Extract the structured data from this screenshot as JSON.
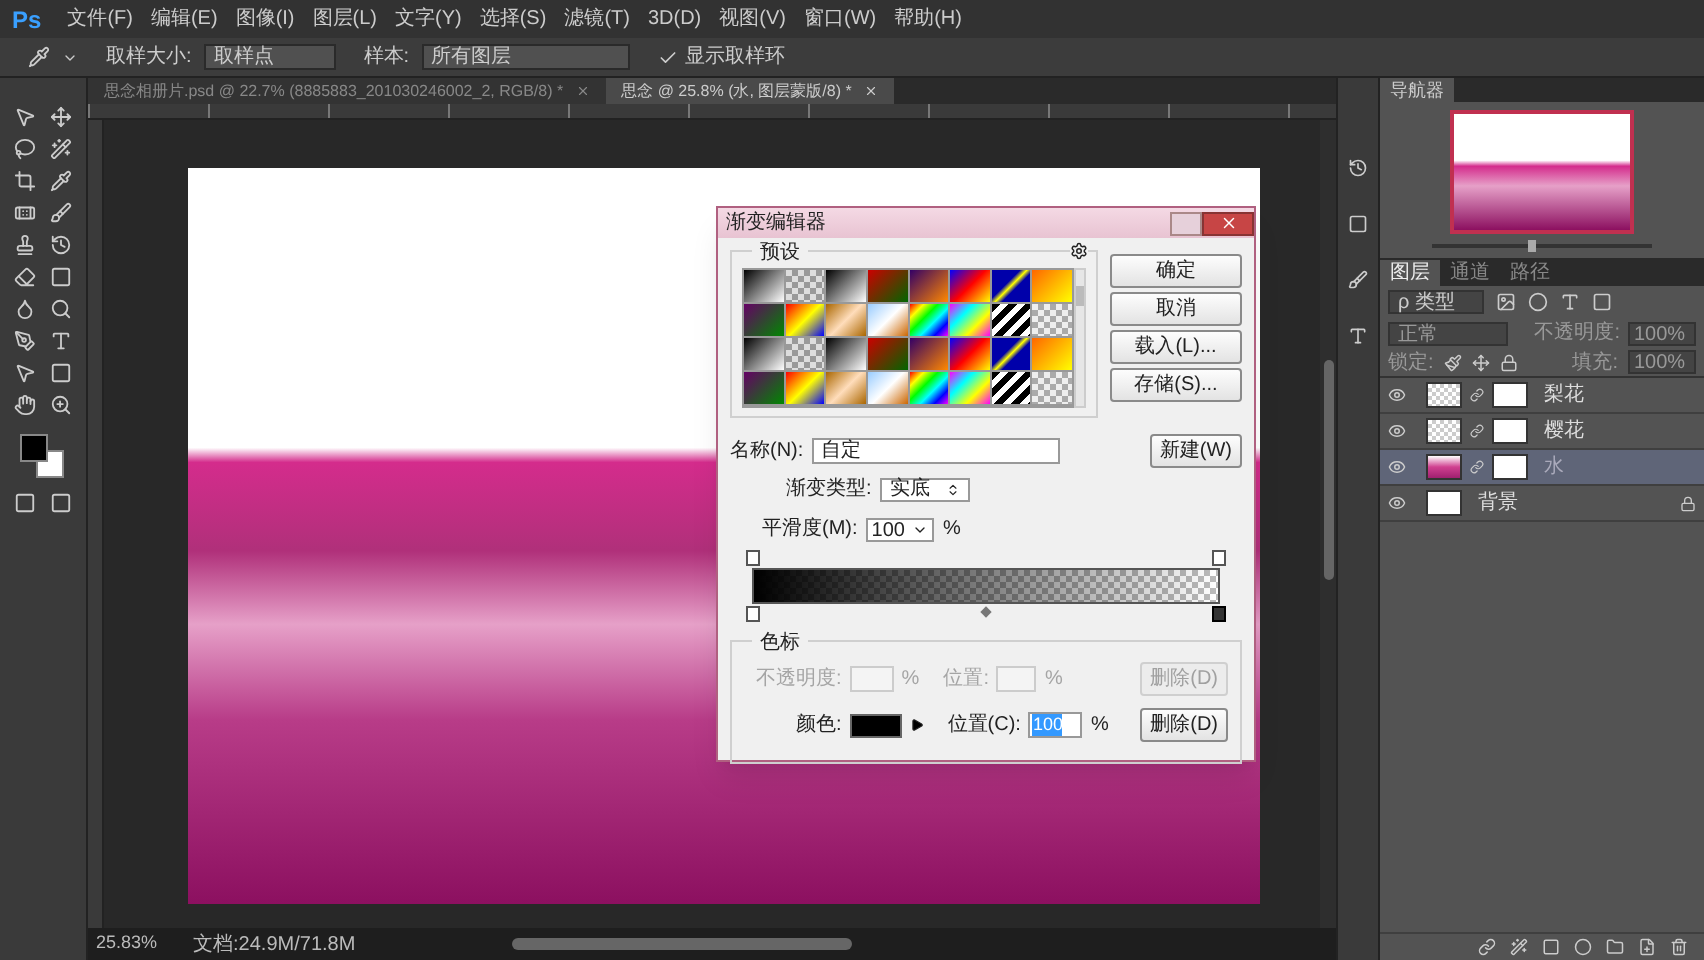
{
  "app_logo": "Ps",
  "menu": [
    "文件(F)",
    "编辑(E)",
    "图像(I)",
    "图层(L)",
    "文字(Y)",
    "选择(S)",
    "滤镜(T)",
    "3D(D)",
    "视图(V)",
    "窗口(W)",
    "帮助(H)"
  ],
  "options_bar": {
    "sample_size_label": "取样大小:",
    "sample_size": "取样点",
    "sample_label": "样本:",
    "sample": "所有图层",
    "show_ring": {
      "label": "显示取样环",
      "checked": true
    }
  },
  "doc_tabs": [
    {
      "label": "思念相册片.psd @ 22.7% (8885883_201030246002_2, RGB/8) *",
      "selected": false
    },
    {
      "label": "思念 @ 25.8% (水, 图层蒙版/8) *",
      "selected": true
    }
  ],
  "status_bar": {
    "zoom": "25.83%",
    "doc_size": "文档:24.9M/71.8M"
  },
  "dialog": {
    "title": "渐变编辑器",
    "presets_label": "预设",
    "buttons": [
      "确定",
      "取消",
      "载入(L)...",
      "存储(S)..."
    ],
    "name_label": "名称(N):",
    "name_value": "自定",
    "new_button": "新建(W)",
    "type_label": "渐变类型:",
    "type_value": "实底",
    "smooth_label": "平滑度(M):",
    "smooth_value": "100",
    "smooth_unit": "%",
    "opacity_stops": [
      {
        "selected": false
      },
      {
        "selected": false
      }
    ],
    "color_stops": [
      {
        "selected": false
      },
      {
        "selected": true
      }
    ],
    "stops_group": {
      "title": "色标",
      "opacity_label": "不透明度:",
      "opacity_unit": "%",
      "opacity_location_label": "位置:",
      "opacity_location_unit": "%",
      "opacity_delete": "删除(D)",
      "opacity_disabled": true,
      "color_label": "颜色:",
      "color": "#000000",
      "location_label": "位置(C):",
      "location_value": "100",
      "location_unit": "%",
      "delete": "删除(D)"
    }
  },
  "navigator": {
    "title": "导航器",
    "level": 0.45
  },
  "layers_panel": {
    "tabs": [
      {
        "label": "图层",
        "selected": true
      },
      {
        "label": "通道",
        "selected": false
      },
      {
        "label": "路径",
        "selected": false
      }
    ],
    "filter": "ρ 类型",
    "blend_mode": "正常",
    "opacity_label": "不透明度:",
    "opacity": "100%",
    "lock_label": "锁定:",
    "fill_label": "填充:",
    "fill": "100%",
    "layers": [
      {
        "name": "梨花",
        "selected": false,
        "visible": true,
        "locked": false,
        "kind": "masked"
      },
      {
        "name": "樱花",
        "selected": false,
        "visible": true,
        "locked": false,
        "kind": "masked"
      },
      {
        "name": "水",
        "selected": true,
        "visible": true,
        "locked": false,
        "kind": "masked"
      },
      {
        "name": "背景",
        "selected": false,
        "visible": true,
        "locked": true,
        "kind": "plain"
      }
    ]
  }
}
